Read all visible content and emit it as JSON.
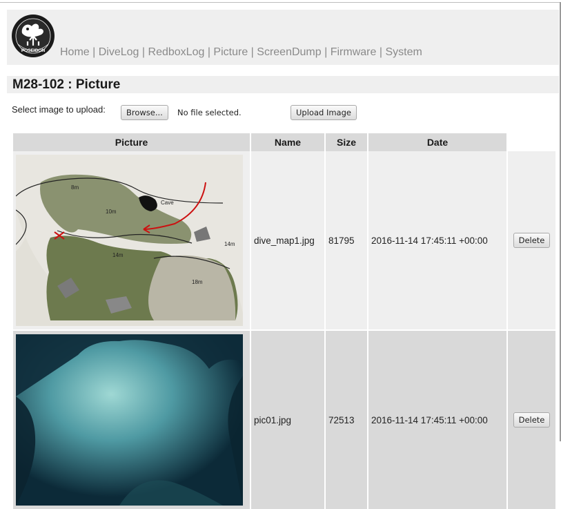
{
  "header": {
    "logo_text": "POSEIDON",
    "nav": [
      "Home",
      "DiveLog",
      "RedboxLog",
      "Picture",
      "ScreenDump",
      "Firmware",
      "System"
    ],
    "separator": "|"
  },
  "page": {
    "title": "M28-102 : Picture"
  },
  "upload": {
    "label": "Select image to upload:",
    "browse_label": "Browse...",
    "file_status": "No file selected.",
    "upload_label": "Upload Image"
  },
  "table": {
    "columns": [
      "Picture",
      "Name",
      "Size",
      "Date"
    ],
    "rows": [
      {
        "name": "dive_map1.jpg",
        "size": "81795",
        "date": "2016-11-14 17:45:11 +00:00",
        "action": "Delete",
        "map_labels": [
          "8m",
          "10m",
          "Cave",
          "14m",
          "14m",
          "18m"
        ]
      },
      {
        "name": "pic01.jpg",
        "size": "72513",
        "date": "2016-11-14 17:45:11 +00:00",
        "action": "Delete"
      }
    ]
  },
  "colors": {
    "header_bg": "#efefef",
    "th_bg": "#d9d9d9",
    "nav_text": "#8a8a8a"
  }
}
